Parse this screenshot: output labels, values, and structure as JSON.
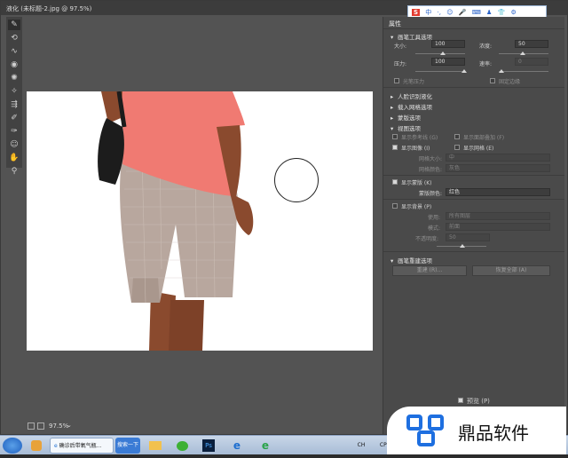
{
  "window": {
    "title": "液化 (未标题-2.jpg @ 97.5%)"
  },
  "ime_bar": {
    "brand": "S",
    "mode": "中",
    "items": [
      "·,",
      "☺",
      "🎤",
      "⌨",
      "♟",
      "👕",
      "⚙"
    ]
  },
  "statusbar": {
    "zoom": "97.5%"
  },
  "panel": {
    "title": "属性",
    "brush_tool_options": {
      "header": "画笔工具选项",
      "size_label": "大小:",
      "size_value": "100",
      "density_label": "浓度:",
      "density_value": "50",
      "pressure_label": "压力:",
      "pressure_value": "100",
      "rate_label": "速率:",
      "rate_value": "0",
      "stylus_label": "光笔压力",
      "pin_edges_label": "固定边缘"
    },
    "face_aware": {
      "header": "人脸识别液化"
    },
    "load_mesh": {
      "header": "载入网格选项"
    },
    "mask_options": {
      "header": "蒙版选项"
    },
    "view_options": {
      "header": "视图选项",
      "show_guides": "显示参考线 (G)",
      "show_face_overlay": "显示面部叠加 (F)",
      "show_image": "显示图像 (I)",
      "show_mesh": "显示网格 (E)",
      "mesh_size_label": "网格大小:",
      "mesh_size_value": "中",
      "mesh_color_label": "网格颜色:",
      "mesh_color_value": "灰色",
      "show_mask": "显示蒙版 (K)",
      "mask_color_label": "蒙版颜色:",
      "mask_color_value": "红色",
      "show_backdrop": "显示背景 (P)",
      "use_label": "使用:",
      "use_value": "所有图层",
      "mode_label": "模式:",
      "mode_value": "前面",
      "opacity_label": "不透明度:",
      "opacity_value": "50"
    },
    "brush_reconstruct": {
      "header": "画笔重建选项",
      "reconstruct_button": "重建 (R)...",
      "restore_all_button": "恢复全部 (A)"
    },
    "preview_label": "预览 (P)"
  },
  "taskbar": {
    "browser_task": "确诊后带氧气瓶...",
    "search_task": "搜索一下",
    "ps_icon": "Ps",
    "tray_text": "CH",
    "tray_cpu": "CPU"
  },
  "watermark": {
    "text": "鼎品软件"
  },
  "colors": {
    "accent_blue": "#1e5fbf",
    "skin": "#8a4a2e",
    "shirt": "#f07a72",
    "pants": "#b8a79e"
  }
}
